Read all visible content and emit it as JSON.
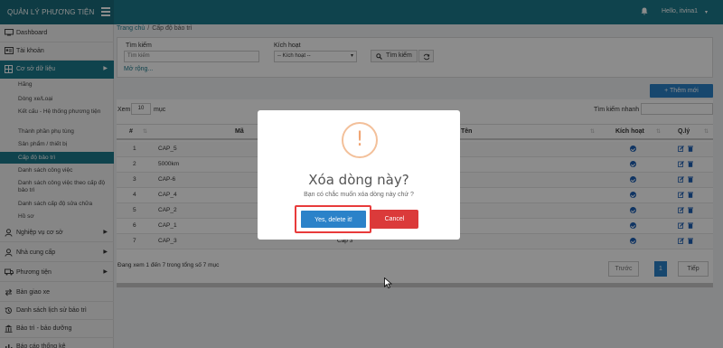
{
  "topbar": {
    "brand": "QUẢN LÝ PHƯƠNG TIỆN",
    "user_greeting": "Hello, itvina1",
    "user_caret": "▾",
    "menu_icon": "hamburger-icon",
    "bell_icon": "bell-icon",
    "color": "#1d7a8c"
  },
  "sidebar": {
    "dashboard": "Dashboard",
    "account": "Tài khoản",
    "database": "Cơ sở dữ liệu",
    "sub": [
      "Hãng",
      "Dòng xe/Loại",
      "Kết cấu - Hệ thống phương tiện",
      "Thành phần phụ tùng",
      "Sản phẩm / thiết bị",
      "Cấp độ bảo trì",
      "Danh sách công việc",
      "Danh sách công việc theo cấp độ bảo trì",
      "Danh sách cấp độ sửa chữa",
      "Hồ sơ"
    ],
    "business": "Nghiệp vụ cơ sở",
    "supplier": "Nhà cung cấp",
    "vehicle": "Phương tiện",
    "handover": "Bàn giao xe",
    "history": "Danh sách lịch sử bảo trì",
    "maintenance": "Bảo trì - bảo dưỡng",
    "reports": "Báo cáo thống kê"
  },
  "breadcrumb": {
    "home": "Trang chủ",
    "sep": "/",
    "current": "Cấp độ bảo trì"
  },
  "filter": {
    "search_label": "Tìm kiếm",
    "search_placeholder": "Tìm kiếm",
    "active_label": "Kích hoạt",
    "active_value": "-- Kích hoạt --",
    "search_button": "Tìm kiếm",
    "more": "Mở rộng..."
  },
  "add_button": "+ Thêm mới",
  "table_controls": {
    "show": "Xem",
    "page_size": "10",
    "unit": "mục",
    "quick_search": "Tìm kiếm nhanh"
  },
  "table": {
    "headers": {
      "index": "#",
      "code": "Mã",
      "name": "Tên",
      "active": "Kích hoạt",
      "manage": "Q.lý"
    },
    "rows": [
      {
        "no": "1",
        "code": "CAP_5",
        "name": ""
      },
      {
        "no": "2",
        "code": "5000km",
        "name": ""
      },
      {
        "no": "3",
        "code": "CAP-6",
        "name": ""
      },
      {
        "no": "4",
        "code": "CAP_4",
        "name": ""
      },
      {
        "no": "5",
        "code": "CAP_2",
        "name": ""
      },
      {
        "no": "6",
        "code": "CAP_1",
        "name": ""
      },
      {
        "no": "7",
        "code": "CAP_3",
        "name": "Cấp 3"
      }
    ]
  },
  "pagination": {
    "info": "Đang xem 1 đến 7 trong tổng số 7 mục",
    "prev": "Trước",
    "page": "1",
    "next": "Tiếp"
  },
  "modal": {
    "icon": "!",
    "title": "Xóa dòng này?",
    "text": "Bạn có chắc muốn xóa dòng này chứ ?",
    "confirm": "Yes, delete it!",
    "cancel": "Cancel",
    "colors": {
      "confirm": "#2b82c9",
      "cancel": "#db3a3a",
      "focus": "#e83b3b"
    }
  }
}
